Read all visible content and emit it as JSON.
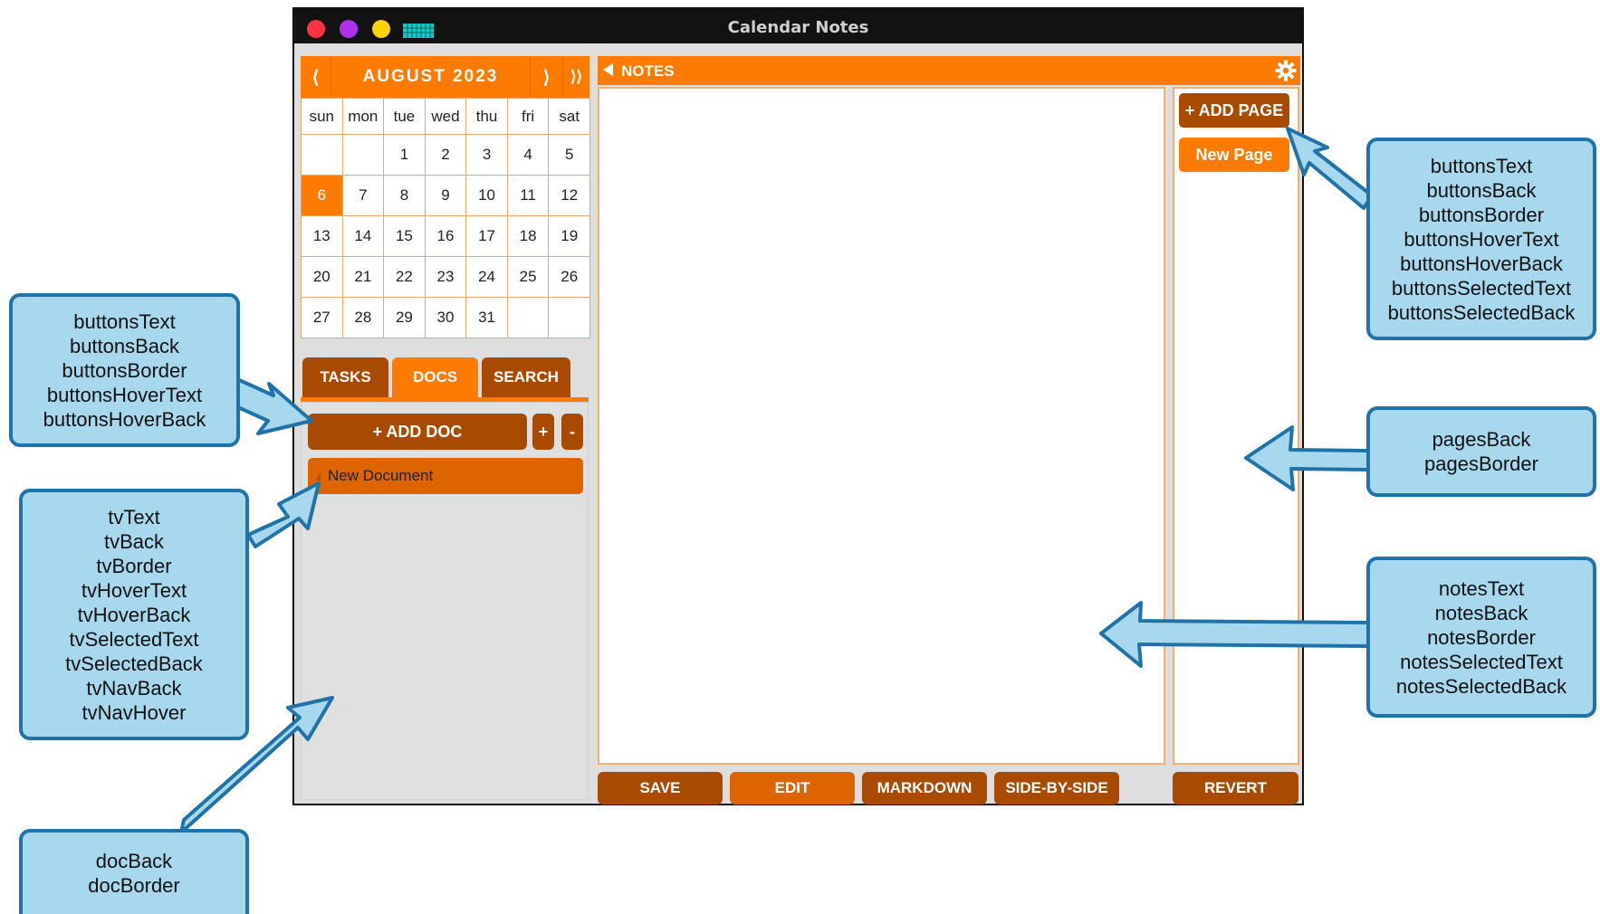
{
  "window": {
    "title": "Calendar Notes"
  },
  "calendar": {
    "prev": "⟨",
    "month": "AUGUST 2023",
    "next": "⟩",
    "next_year": "⟩⟩",
    "weekdays": [
      "sun",
      "mon",
      "tue",
      "wed",
      "thu",
      "fri",
      "sat"
    ],
    "weeks": [
      [
        "",
        "",
        "1",
        "2",
        "3",
        "4",
        "5"
      ],
      [
        "6",
        "7",
        "8",
        "9",
        "10",
        "11",
        "12"
      ],
      [
        "13",
        "14",
        "15",
        "16",
        "17",
        "18",
        "19"
      ],
      [
        "20",
        "21",
        "22",
        "23",
        "24",
        "25",
        "26"
      ],
      [
        "27",
        "28",
        "29",
        "30",
        "31",
        "",
        ""
      ]
    ],
    "selected_day": "6"
  },
  "tabs": [
    "TASKS",
    "DOCS",
    "SEARCH"
  ],
  "active_tab": "DOCS",
  "docs": {
    "add_doc": "+ ADD DOC",
    "plus": "+",
    "minus": "-",
    "items": [
      "New Document"
    ]
  },
  "notes": {
    "header": "NOTES",
    "add_page": "+ ADD PAGE",
    "pages": [
      "New Page"
    ]
  },
  "bottom_buttons": {
    "save": "SAVE",
    "edit": "EDIT",
    "markdown": "MARKDOWN",
    "side_by_side": "SIDE-BY-SIDE",
    "revert": "REVERT"
  },
  "callouts": {
    "page_buttons": [
      "buttonsText",
      "buttonsBack",
      "buttonsBorder",
      "buttonsHoverText",
      "buttonsHoverBack",
      "buttonsSelectedText",
      "buttonsSelectedBack"
    ],
    "doc_buttons": [
      "buttonsText",
      "buttonsBack",
      "buttonsBorder",
      "buttonsHoverText",
      "buttonsHoverBack"
    ],
    "tree_view": [
      "tvText",
      "tvBack",
      "tvBorder",
      "tvHoverText",
      "tvHoverBack",
      "tvSelectedText",
      "tvSelectedBack",
      "tvNavBack",
      "tvNavHover"
    ],
    "pages": [
      "pagesBack",
      "pagesBorder"
    ],
    "notes": [
      "notesText",
      "notesBack",
      "notesBorder",
      "notesSelectedText",
      "notesSelectedBack"
    ],
    "doc": [
      "docBack",
      "docBorder"
    ]
  },
  "colors": {
    "accent": "#ff7a00",
    "button_dark": "#a84b00",
    "button_mid": "#de6400",
    "callout_fill": "#a8d8ee",
    "callout_border": "#1f73a8"
  }
}
